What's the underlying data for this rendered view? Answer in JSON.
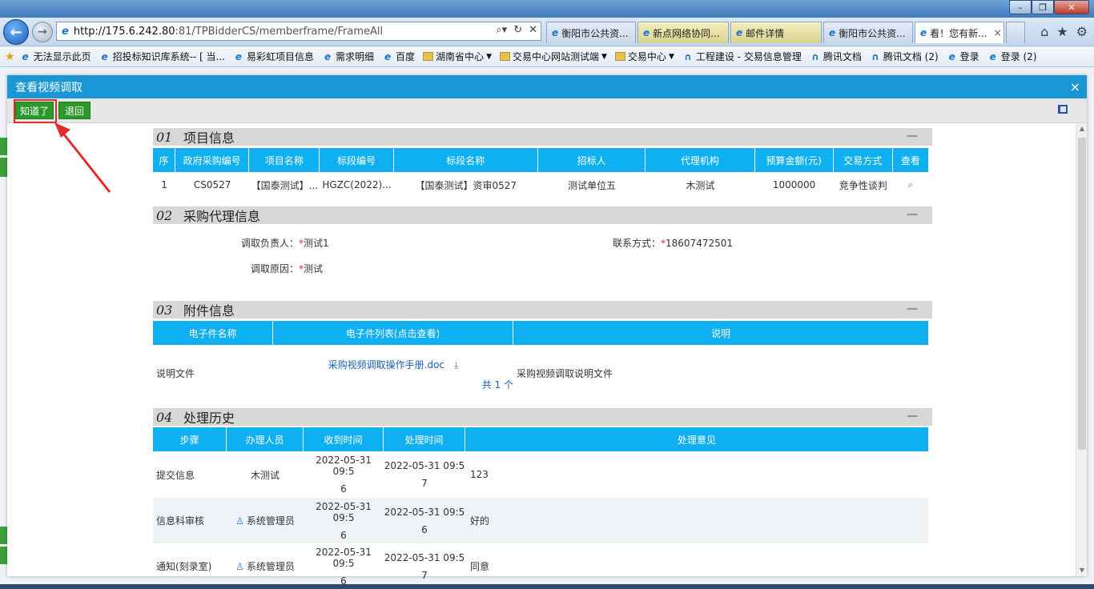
{
  "browser": {
    "url": "http://175.6.242.80:81/TPBidderCS/memberframe/FrameAll",
    "url_host": "http://175.6.242.80",
    "url_rest": ":81/TPBidderCS/memberframe/FrameAll",
    "tabs": [
      {
        "label": "衡阳市公共资...",
        "style": "normal"
      },
      {
        "label": "新点网络协同...",
        "style": "y"
      },
      {
        "label": "邮件详情",
        "style": "y"
      },
      {
        "label": "衡阳市公共资...",
        "style": "normal"
      },
      {
        "label": "看！您有新...",
        "style": "active"
      }
    ],
    "tab_close": "×",
    "favorites": [
      {
        "label": "无法显示此页",
        "icon": "ie"
      },
      {
        "label": "招投标知识库系统-- [ 当...",
        "icon": "ie"
      },
      {
        "label": "易彩虹项目信息",
        "icon": "ie"
      },
      {
        "label": "需求明细",
        "icon": "ie"
      },
      {
        "label": "百度",
        "icon": "ie"
      },
      {
        "label": "湖南省中心",
        "icon": "folder",
        "dropdown": true
      },
      {
        "label": "交易中心网站测试端",
        "icon": "folder",
        "dropdown": true
      },
      {
        "label": "交易中心",
        "icon": "folder",
        "dropdown": true
      },
      {
        "label": "工程建设 - 交易信息管理",
        "icon": "tx"
      },
      {
        "label": "腾讯文档",
        "icon": "tx"
      },
      {
        "label": "腾讯文档 (2)",
        "icon": "tx"
      },
      {
        "label": "登录",
        "icon": "ie"
      },
      {
        "label": "登录 (2)",
        "icon": "ie"
      }
    ]
  },
  "dialog": {
    "title": "查看视频调取",
    "close": "×",
    "buttons": {
      "known": "知道了",
      "back": "退回"
    }
  },
  "sections": {
    "s1": {
      "num": "01",
      "title": "项目信息",
      "collapse": "—"
    },
    "s2": {
      "num": "02",
      "title": "采购代理信息",
      "collapse": "—"
    },
    "s3": {
      "num": "03",
      "title": "附件信息",
      "collapse": "—"
    },
    "s4": {
      "num": "04",
      "title": "处理历史",
      "collapse": "—"
    }
  },
  "project": {
    "headers": [
      "序",
      "政府采购编号",
      "项目名称",
      "标段编号",
      "标段名称",
      "招标人",
      "代理机构",
      "预算金额(元)",
      "交易方式",
      "查看"
    ],
    "row": [
      "1",
      "CS0527",
      "【国泰测试】...",
      "HGZC(2022)...",
      "【国泰测试】资审0527",
      "测试单位五",
      "木测试",
      "1000000",
      "竞争性谈判"
    ]
  },
  "agent": {
    "owner_label": "调取负责人：",
    "owner_value": "测试1",
    "contact_label": "联系方式：",
    "contact_value": "18607472501",
    "reason_label": "调取原因：",
    "reason_value": "测试",
    "required_mark": "*"
  },
  "attachments": {
    "headers": [
      "电子件名称",
      "电子件列表(点击查看)",
      "说明"
    ],
    "name": "说明文件",
    "file": "采购视频调取操作手册.doc",
    "total": "共 1 个",
    "desc": "采购视频调取说明文件"
  },
  "history": {
    "headers": [
      "步骤",
      "办理人员",
      "收到时间",
      "处理时间",
      "处理意见"
    ],
    "rows": [
      {
        "step": "提交信息",
        "user": "木测试",
        "recv_a": "2022-05-31 09:5",
        "recv_b": "6",
        "proc_a": "2022-05-31 09:5",
        "proc_b": "7",
        "opinion": "123",
        "icon": false
      },
      {
        "step": "信息科审核",
        "user": "系统管理员",
        "recv_a": "2022-05-31 09:5",
        "recv_b": "6",
        "proc_a": "2022-05-31 09:5",
        "proc_b": "6",
        "opinion": "好的",
        "icon": true
      },
      {
        "step": "通知(刻录室)",
        "user": "系统管理员",
        "recv_a": "2022-05-31 09:5",
        "recv_b": "6",
        "proc_a": "2022-05-31 09:5",
        "proc_b": "7",
        "opinion": "同意",
        "icon": true
      }
    ]
  },
  "colors": {
    "header_blue": "#1a96d4",
    "table_head": "#0fb0f2",
    "button_green": "#2b9a2b",
    "annotation_red": "#e52a2a"
  }
}
